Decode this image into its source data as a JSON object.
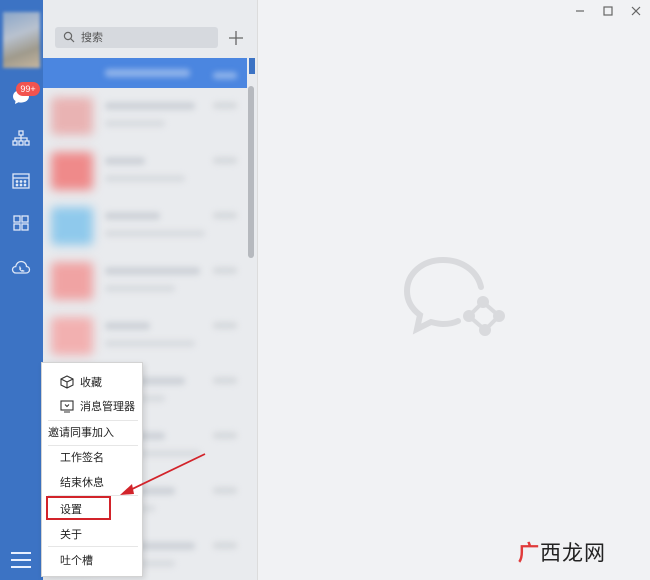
{
  "search": {
    "placeholder": "搜索"
  },
  "nav": {
    "badge": "99+",
    "icons": [
      "chat-icon",
      "org-chart-icon",
      "calendar-icon",
      "apps-grid-icon",
      "cloud-phone-icon"
    ],
    "menu_icon": "hamburger-icon"
  },
  "menu": {
    "items": [
      {
        "label": "收藏",
        "icon": "cube-icon"
      },
      {
        "label": "消息管理器",
        "icon": "message-manager-icon"
      },
      {
        "label": "邀请同事加入"
      },
      {
        "label": "工作签名"
      },
      {
        "label": "结束休息"
      },
      {
        "label": "设置"
      },
      {
        "label": "关于"
      },
      {
        "label": "吐个槽"
      }
    ],
    "highlighted": "设置"
  },
  "window": {
    "controls": [
      "minimize-icon",
      "maximize-icon",
      "close-icon"
    ]
  },
  "watermark": {
    "mark": "广",
    "text": "西龙网"
  },
  "colors": {
    "sidebar": "#3c73c4",
    "badge": "#f2534f",
    "highlight": "#d2232a",
    "selected_row": "#4b86e0"
  }
}
